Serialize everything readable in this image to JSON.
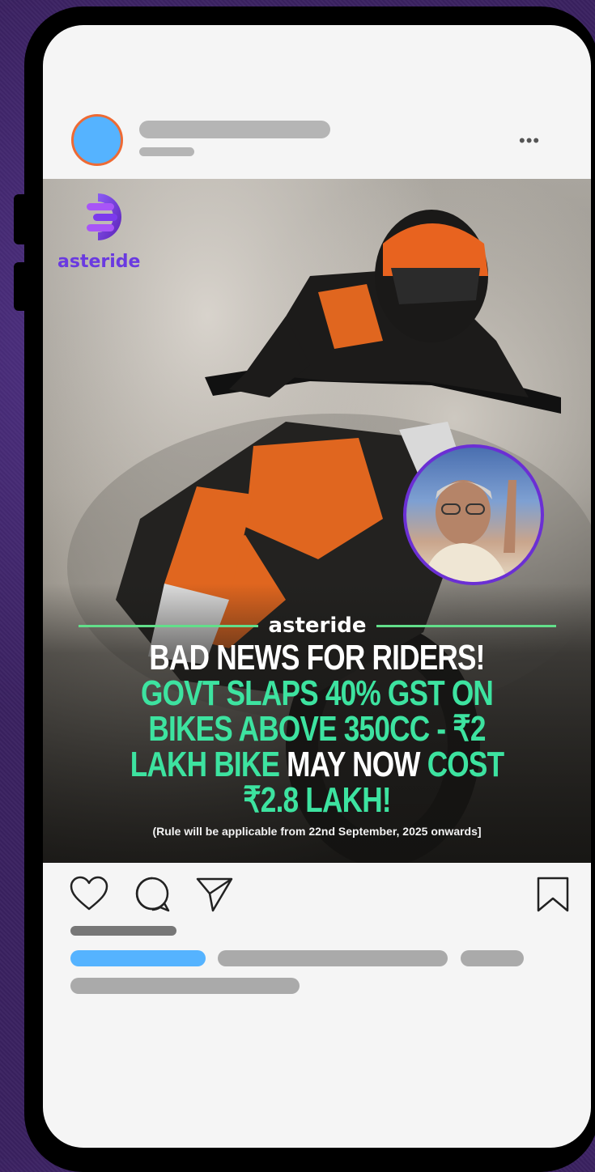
{
  "post": {
    "more_label": "•••",
    "brand_name": "asteride",
    "divider_label": "asteride",
    "headline": {
      "white_1": "BAD NEWS FOR RIDERS! ",
      "green_1": "GOVT SLAPS 40% GST ON BIKES ABOVE 350CC - ₹2 LAKH BIKE ",
      "white_2": "MAY NOW ",
      "green_2": "COST ₹2.8 LAKH!"
    },
    "footnote": "(Rule will be applicable from 22nd September, 2025 onwards]"
  },
  "icons": {
    "more": "more-options-icon",
    "like": "heart-icon",
    "comment": "comment-icon",
    "share": "send-icon",
    "save": "bookmark-icon"
  },
  "colors": {
    "background": "#3a2160",
    "avatar_fill": "#55b3ff",
    "avatar_ring": "#ee6a34",
    "brand_purple": "#6a3ae0",
    "headline_green": "#3de3a0",
    "divider_green": "#62df8a",
    "skeleton_grey": "#b5b5b5",
    "caption_blue": "#55b3ff"
  }
}
